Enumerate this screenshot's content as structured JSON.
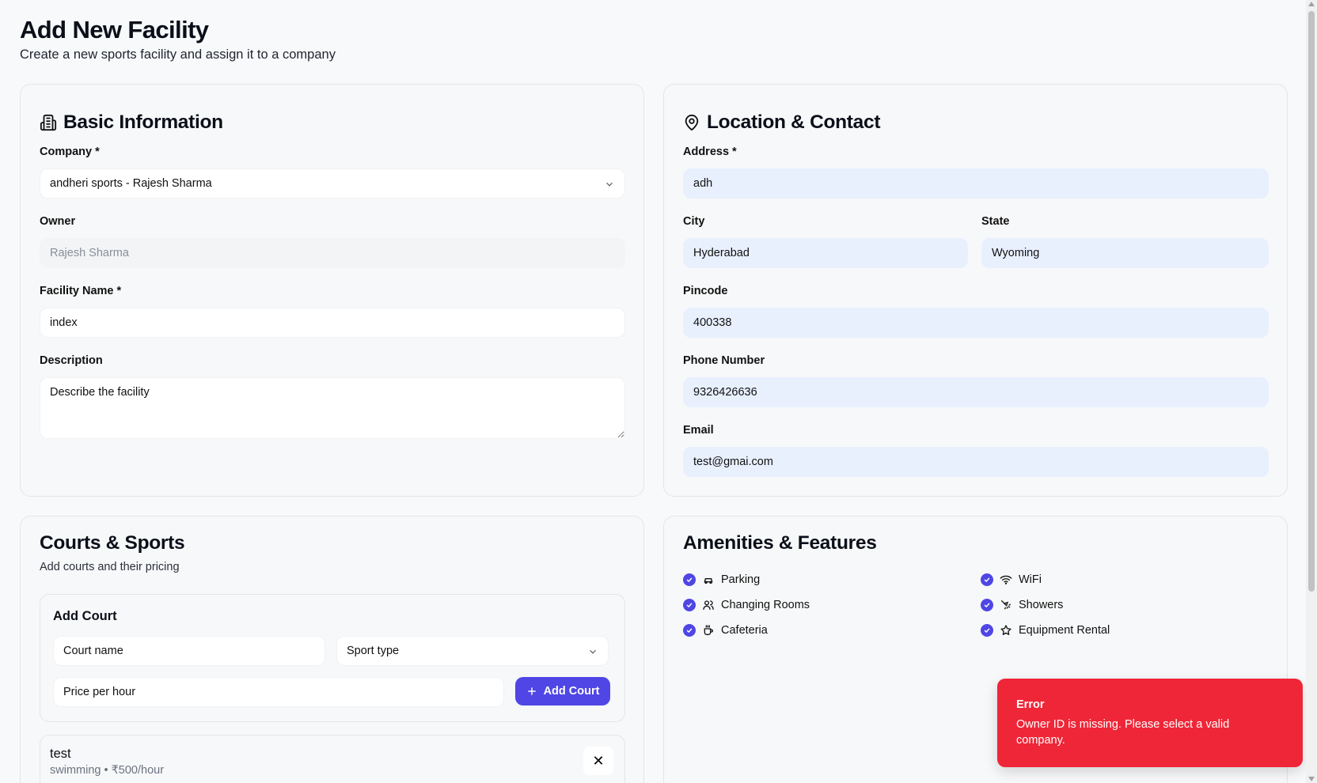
{
  "header": {
    "title": "Add New Facility",
    "subtitle": "Create a new sports facility and assign it to a company"
  },
  "basic": {
    "title": "Basic Information",
    "icon": "building-icon",
    "company_label": "Company *",
    "company_value": "andheri sports - Rajesh Sharma",
    "owner_label": "Owner",
    "owner_value": "Rajesh Sharma",
    "facility_label": "Facility Name *",
    "facility_value": "index",
    "description_label": "Description",
    "description_placeholder": "Describe the facility"
  },
  "location": {
    "title": "Location & Contact",
    "icon": "map-pin-icon",
    "address_label": "Address *",
    "address_value": "adh",
    "city_label": "City",
    "city_value": "Hyderabad",
    "state_label": "State",
    "state_value": "Wyoming",
    "pincode_label": "Pincode",
    "pincode_value": "400338",
    "phone_label": "Phone Number",
    "phone_value": "9326426636",
    "email_label": "Email",
    "email_value": "test@gmai.com"
  },
  "courts": {
    "title": "Courts & Sports",
    "subtitle": "Add courts and their pricing",
    "add_title": "Add Court",
    "court_name_placeholder": "Court name",
    "sport_type_placeholder": "Sport type",
    "price_placeholder": "Price per hour",
    "add_button": "Add Court",
    "items": [
      {
        "name": "test",
        "detail": "swimming • ₹500/hour",
        "remove": "✕"
      }
    ]
  },
  "amenities": {
    "title": "Amenities & Features",
    "items": [
      {
        "label": "Parking",
        "icon": "car-icon",
        "checked": true
      },
      {
        "label": "WiFi",
        "icon": "wifi-icon",
        "checked": true
      },
      {
        "label": "Changing Rooms",
        "icon": "users-icon",
        "checked": true
      },
      {
        "label": "Showers",
        "icon": "shower-icon",
        "checked": true
      },
      {
        "label": "Cafeteria",
        "icon": "coffee-icon",
        "checked": true
      },
      {
        "label": "Equipment Rental",
        "icon": "star-icon",
        "checked": true
      }
    ]
  },
  "toast": {
    "title": "Error",
    "message": "Owner ID is missing. Please select a valid company."
  },
  "colors": {
    "accent": "#4f46e5",
    "error": "#ef2637",
    "autofill": "#e8f0fe"
  }
}
